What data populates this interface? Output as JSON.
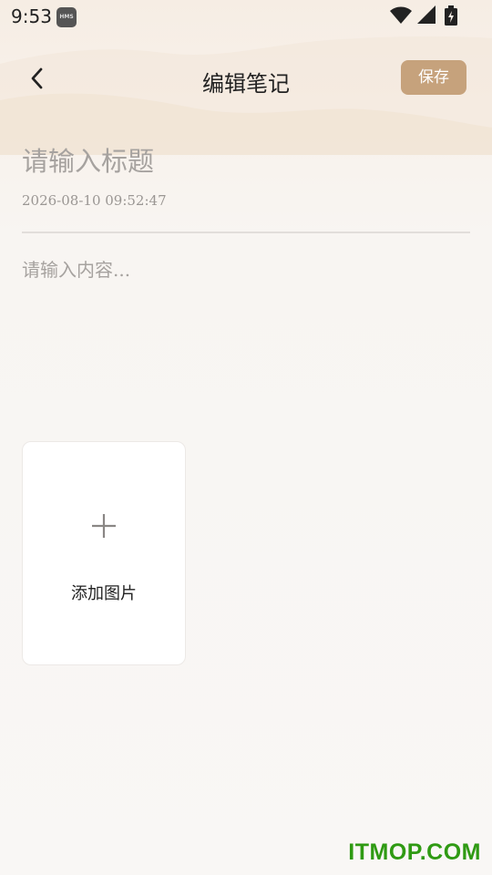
{
  "status_bar": {
    "time": "9:53",
    "notification_badge": "HMS",
    "icons": [
      "wifi-icon",
      "signal-icon",
      "battery-charging-icon"
    ]
  },
  "header": {
    "title": "编辑笔记",
    "back_icon": "chevron-left-icon",
    "save_label": "保存"
  },
  "editor": {
    "title_placeholder": "请输入标题",
    "title_value": "",
    "timestamp": "2026-08-10 09:52:47",
    "content_placeholder": "请输入内容...",
    "content_value": ""
  },
  "attachments": {
    "add_icon": "plus-icon",
    "add_label": "添加图片"
  },
  "watermark": "ITMOP.COM",
  "colors": {
    "accent": "#c6a27c",
    "background": "#f9f7f5",
    "watermark": "#2f9a13"
  }
}
